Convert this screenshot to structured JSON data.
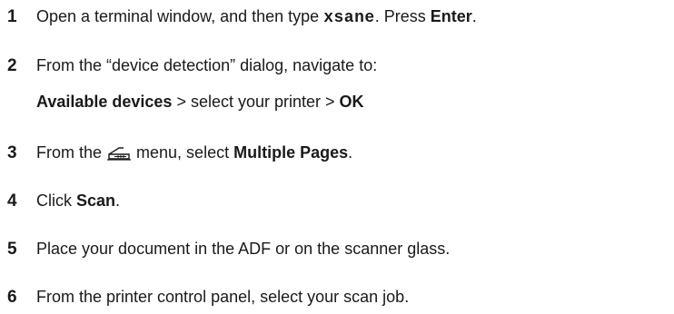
{
  "steps": [
    {
      "number": "1",
      "parts": {
        "a": "Open a terminal window, and then type ",
        "code": "xsane",
        "b": ". Press ",
        "bold": "Enter",
        "c": "."
      }
    },
    {
      "number": "2",
      "parts": {
        "a": "From the “device detection” dialog, navigate to:",
        "line2_bold1": "Available devices",
        "line2_mid": " > select your printer  > ",
        "line2_bold2": "OK"
      }
    },
    {
      "number": "3",
      "parts": {
        "a": "From the ",
        "icon": "scanner-icon",
        "b": " menu, select ",
        "bold": "Multiple Pages",
        "c": "."
      }
    },
    {
      "number": "4",
      "parts": {
        "a": "Click ",
        "bold": "Scan",
        "c": "."
      }
    },
    {
      "number": "5",
      "parts": {
        "a": "Place your document in the ADF or on the scanner glass."
      }
    },
    {
      "number": "6",
      "parts": {
        "a": "From the printer control panel, select your scan job."
      }
    }
  ]
}
